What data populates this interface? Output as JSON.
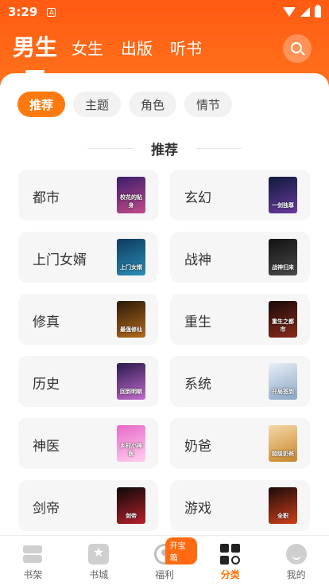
{
  "status_bar": {
    "time": "3:29",
    "notify_icon": "A"
  },
  "top_tabs": [
    {
      "label": "男生",
      "active": true
    },
    {
      "label": "女生",
      "active": false
    },
    {
      "label": "出版",
      "active": false
    },
    {
      "label": "听书",
      "active": false
    }
  ],
  "filter_chips": [
    {
      "label": "推荐",
      "active": true
    },
    {
      "label": "主题",
      "active": false
    },
    {
      "label": "角色",
      "active": false
    },
    {
      "label": "情节",
      "active": false
    }
  ],
  "section_title": "推荐",
  "categories": [
    {
      "label": "都市",
      "cover_text": "校花的贴身",
      "cover_colors": [
        "#3a1d6b",
        "#c34a8a"
      ]
    },
    {
      "label": "玄幻",
      "cover_text": "一剑独尊",
      "cover_colors": [
        "#0e1a3a",
        "#6b3aa0"
      ]
    },
    {
      "label": "上门女婿",
      "cover_text": "上门女婿",
      "cover_colors": [
        "#0f3a5c",
        "#2a8fb8"
      ]
    },
    {
      "label": "战神",
      "cover_text": "战神归来",
      "cover_colors": [
        "#111111",
        "#4a4a4a"
      ]
    },
    {
      "label": "修真",
      "cover_text": "最强修仙",
      "cover_colors": [
        "#2a1a0a",
        "#b56a1a"
      ]
    },
    {
      "label": "重生",
      "cover_text": "重生之都市",
      "cover_colors": [
        "#1a0a0a",
        "#8a2a1a"
      ]
    },
    {
      "label": "历史",
      "cover_text": "回到明朝",
      "cover_colors": [
        "#2a1a4a",
        "#c36ad0"
      ]
    },
    {
      "label": "系统",
      "cover_text": "开局签到",
      "cover_colors": [
        "#e8eef6",
        "#8aa6c8"
      ]
    },
    {
      "label": "神医",
      "cover_text": "乡村小神医",
      "cover_colors": [
        "#e868c8",
        "#ffd0f0"
      ]
    },
    {
      "label": "奶爸",
      "cover_text": "超级奶爸",
      "cover_colors": [
        "#f5d7a8",
        "#c6862a"
      ]
    },
    {
      "label": "剑帝",
      "cover_text": "剑帝",
      "cover_colors": [
        "#0a0a0a",
        "#b8202a"
      ]
    },
    {
      "label": "游戏",
      "cover_text": "全职",
      "cover_colors": [
        "#1a0a0a",
        "#d0401a"
      ]
    }
  ],
  "bottom_nav": [
    {
      "label": "书架",
      "icon": "bookshelf-icon",
      "active": false
    },
    {
      "label": "书城",
      "icon": "bookstore-icon",
      "active": false
    },
    {
      "label": "福利",
      "icon": "welfare-icon",
      "active": false,
      "badge": "开宝箱"
    },
    {
      "label": "分类",
      "icon": "category-icon",
      "active": true
    },
    {
      "label": "我的",
      "icon": "profile-icon",
      "active": false
    }
  ],
  "colors": {
    "accent": "#ff6f00",
    "header": "#ff5a12",
    "chip_inactive": "#f2f2f2",
    "card_bg": "#f6f6f6"
  }
}
